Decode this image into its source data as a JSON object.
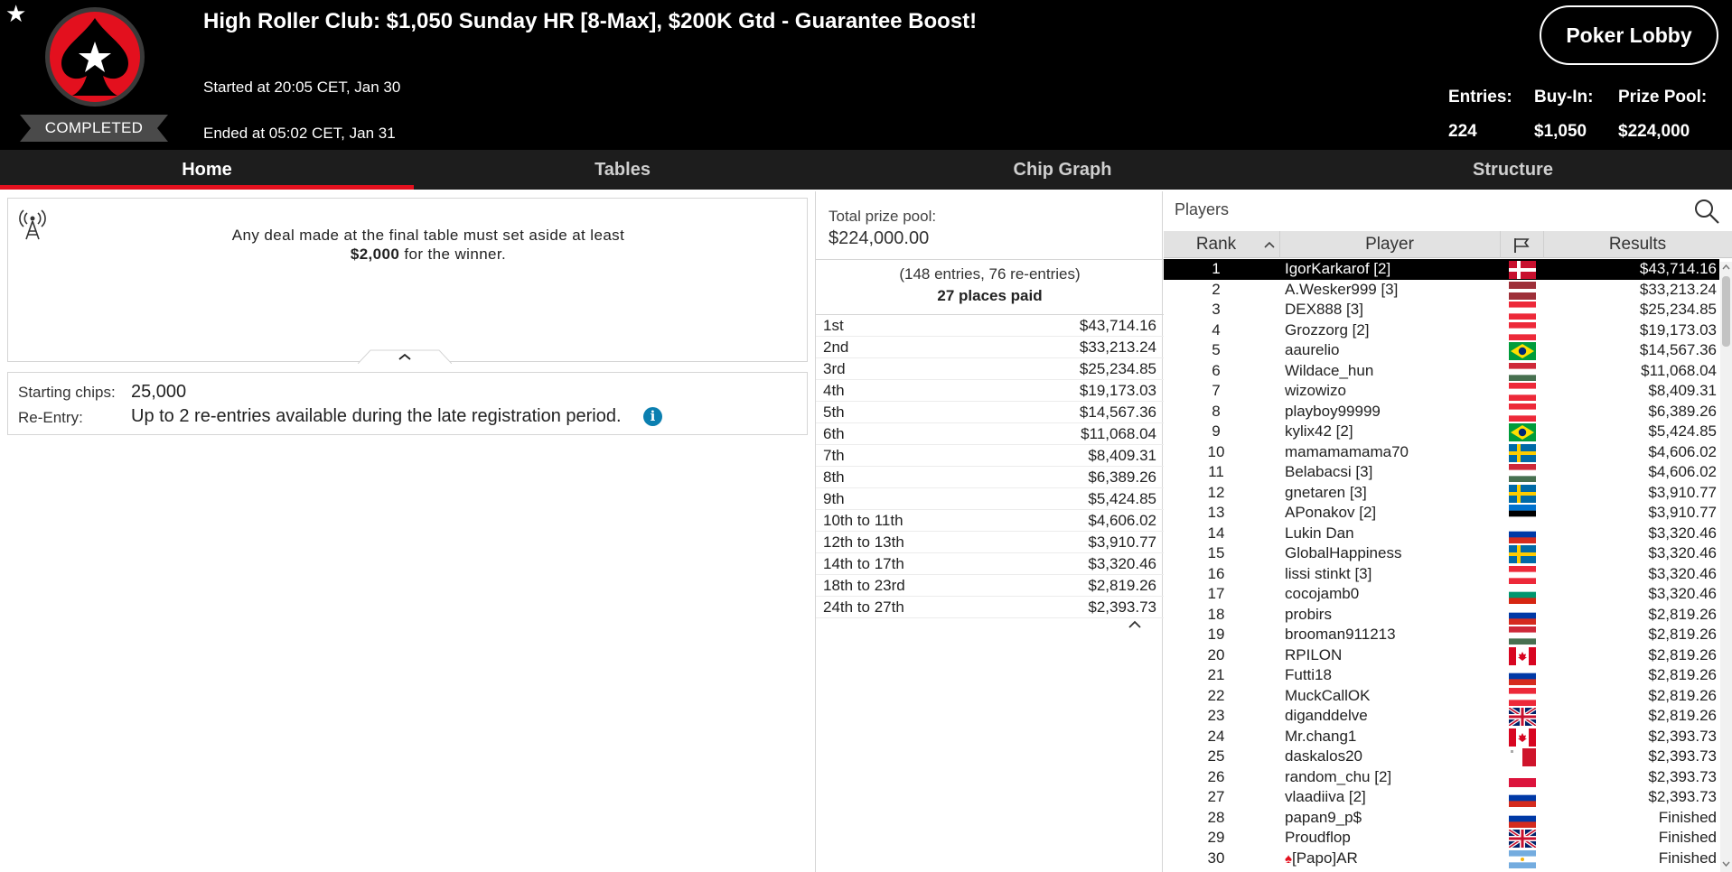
{
  "header": {
    "title": "High Roller Club: $1,050 Sunday HR [8-Max], $200K Gtd - Guarantee Boost!",
    "status": "COMPLETED",
    "started": "Started at 20:05 CET, Jan 30",
    "ended": "Ended at 05:02 CET, Jan 31",
    "lobby_button": "Poker Lobby",
    "stats": {
      "entries_label": "Entries:",
      "entries_value": "224",
      "buyin_label": "Buy-In:",
      "buyin_value": "$1,050",
      "prizepool_label": "Prize Pool:",
      "prizepool_value": "$224,000"
    },
    "icons": [
      "star-icon",
      "pokerstars-spade-logo"
    ]
  },
  "tabs": [
    {
      "label": "Home",
      "active": true
    },
    {
      "label": "Tables",
      "active": false
    },
    {
      "label": "Chip Graph",
      "active": false
    },
    {
      "label": "Structure",
      "active": false
    }
  ],
  "info": {
    "deal_line1": "Any deal made at the final table must set aside at least",
    "deal_amount": "$2,000",
    "deal_line2_rest": " for the winner.",
    "starting_chips_label": "Starting chips:",
    "starting_chips_value": "25,000",
    "reentry_label": "Re-Entry:",
    "reentry_value": "Up to 2 re-entries available during the late registration period.",
    "info_icon_glyph": "i"
  },
  "prizes": {
    "total_label": "Total prize pool:",
    "total_value": "$224,000.00",
    "entries_text": "(148 entries, 76 re-entries)",
    "places_paid": "27 places paid",
    "payouts": [
      {
        "place": "1st",
        "amount": "$43,714.16"
      },
      {
        "place": "2nd",
        "amount": "$33,213.24"
      },
      {
        "place": "3rd",
        "amount": "$25,234.85"
      },
      {
        "place": "4th",
        "amount": "$19,173.03"
      },
      {
        "place": "5th",
        "amount": "$14,567.36"
      },
      {
        "place": "6th",
        "amount": "$11,068.04"
      },
      {
        "place": "7th",
        "amount": "$8,409.31"
      },
      {
        "place": "8th",
        "amount": "$6,389.26"
      },
      {
        "place": "9th",
        "amount": "$5,424.85"
      },
      {
        "place": "10th to 11th",
        "amount": "$4,606.02"
      },
      {
        "place": "12th to 13th",
        "amount": "$3,910.77"
      },
      {
        "place": "14th to 17th",
        "amount": "$3,320.46"
      },
      {
        "place": "18th to 23rd",
        "amount": "$2,819.26"
      },
      {
        "place": "24th to 27th",
        "amount": "$2,393.73"
      }
    ]
  },
  "players_panel": {
    "label": "Players",
    "columns": {
      "rank": "Rank",
      "player": "Player",
      "results": "Results"
    },
    "rows": [
      {
        "rank": "1",
        "name": "IgorKarkarof [2]",
        "flag": "denmark",
        "result": "$43,714.16",
        "selected": true
      },
      {
        "rank": "2",
        "name": "A.Wesker999 [3]",
        "flag": "latvia",
        "result": "$33,213.24"
      },
      {
        "rank": "3",
        "name": "DEX888 [3]",
        "flag": "austria",
        "result": "$25,234.85"
      },
      {
        "rank": "4",
        "name": "Grozzorg [2]",
        "flag": "austria",
        "result": "$19,173.03"
      },
      {
        "rank": "5",
        "name": "aaurelio",
        "flag": "brazil",
        "result": "$14,567.36"
      },
      {
        "rank": "6",
        "name": "Wildace_hun",
        "flag": "hungary",
        "result": "$11,068.04"
      },
      {
        "rank": "7",
        "name": "wizowizo",
        "flag": "austria",
        "result": "$8,409.31"
      },
      {
        "rank": "8",
        "name": "playboy99999",
        "flag": "austria",
        "result": "$6,389.26"
      },
      {
        "rank": "9",
        "name": "kylix42 [2]",
        "flag": "brazil",
        "result": "$5,424.85"
      },
      {
        "rank": "10",
        "name": "mamamamama70",
        "flag": "sweden",
        "result": "$4,606.02"
      },
      {
        "rank": "11",
        "name": "Belabacsi [3]",
        "flag": "hungary",
        "result": "$4,606.02"
      },
      {
        "rank": "12",
        "name": "gnetaren [3]",
        "flag": "sweden",
        "result": "$3,910.77"
      },
      {
        "rank": "13",
        "name": "APonakov [2]",
        "flag": "estonia",
        "result": "$3,910.77"
      },
      {
        "rank": "14",
        "name": "Lukin Dan",
        "flag": "russia",
        "result": "$3,320.46"
      },
      {
        "rank": "15",
        "name": "GlobalHappiness",
        "flag": "sweden",
        "result": "$3,320.46"
      },
      {
        "rank": "16",
        "name": "lissi stinkt [3]",
        "flag": "austria",
        "result": "$3,320.46"
      },
      {
        "rank": "17",
        "name": "cocojamb0",
        "flag": "bulgaria",
        "result": "$3,320.46"
      },
      {
        "rank": "18",
        "name": "probirs",
        "flag": "russia",
        "result": "$2,819.26"
      },
      {
        "rank": "19",
        "name": "brooman911213",
        "flag": "hungary",
        "result": "$2,819.26"
      },
      {
        "rank": "20",
        "name": "RPILON",
        "flag": "canada",
        "result": "$2,819.26"
      },
      {
        "rank": "21",
        "name": "Futti18",
        "flag": "russia",
        "result": "$2,819.26"
      },
      {
        "rank": "22",
        "name": "MuckCallOK",
        "flag": "austria",
        "result": "$2,819.26"
      },
      {
        "rank": "23",
        "name": "diganddelve",
        "flag": "uk",
        "result": "$2,819.26"
      },
      {
        "rank": "24",
        "name": "Mr.chang1",
        "flag": "canada",
        "result": "$2,393.73"
      },
      {
        "rank": "25",
        "name": "daskalos20",
        "flag": "malta",
        "result": "$2,393.73"
      },
      {
        "rank": "26",
        "name": "random_chu [2]",
        "flag": "poland",
        "result": "$2,393.73"
      },
      {
        "rank": "27",
        "name": "vlaadiiva [2]",
        "flag": "russia",
        "result": "$2,393.73"
      },
      {
        "rank": "28",
        "name": "papan9_p$",
        "flag": "russia",
        "result": "Finished"
      },
      {
        "rank": "29",
        "name": "Proudflop",
        "flag": "uk",
        "result": "Finished"
      },
      {
        "rank": "30",
        "name": "[Papo]AR",
        "flag": "argentina",
        "result": "Finished",
        "pokerstars_pro": true
      }
    ]
  },
  "colors": {
    "header_bg": "#000000",
    "nav_bg": "#1d1d1d",
    "accent_red": "#e3101e",
    "info_blue": "#0b7fb0",
    "selected_row_bg": "#000000"
  }
}
